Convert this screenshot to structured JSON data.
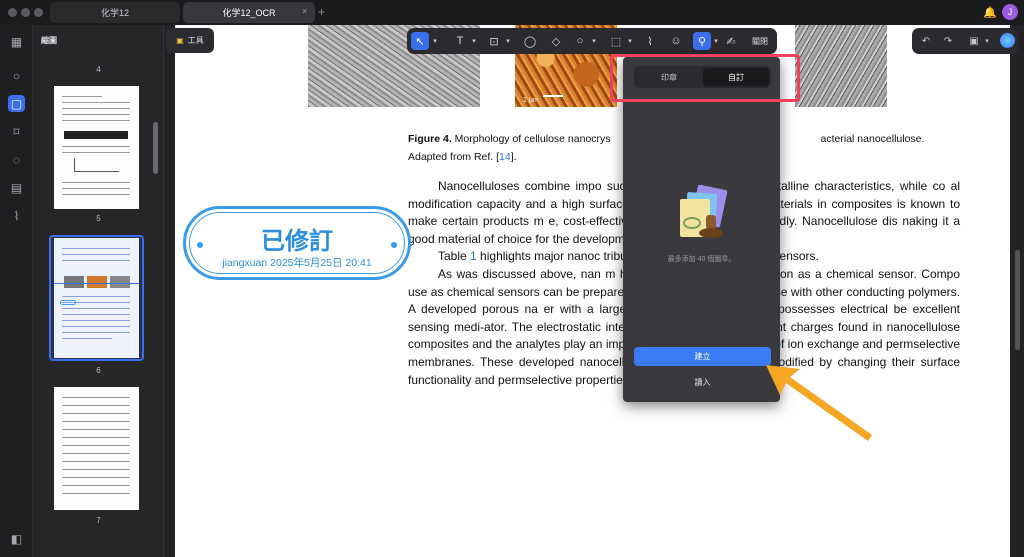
{
  "tabs": [
    {
      "label": "化学12"
    },
    {
      "label": "化学12_OCR",
      "close": "×"
    }
  ],
  "tab_add": "+",
  "user": {
    "initial": "J"
  },
  "thumbnails": {
    "title": "縮圖",
    "page_numbers": [
      "4",
      "5",
      "6",
      "7"
    ]
  },
  "tools_button": {
    "label": "工具"
  },
  "toolbar": {
    "close_label": "關閉"
  },
  "document": {
    "caption_bold": "Figure 4.",
    "caption_text1": " Morphology of cellulose nanocrys",
    "caption_text2": "acterial nanocellulose.",
    "caption_line2_pre": "Adapted from Ref. [",
    "caption_ref": "14",
    "caption_line2_post": "].",
    "scale_label": "1 µm",
    "p1": "Nanocelluloses combine impo                                such as hydrophilicity and crystalline characteristics, while co                          al modification capacity and a high surface area. The use of na                        er materials in composites is known to make certain products m                        e, cost-effective and environ-mentally friendly. Nanocellulose dis                      naking it a good material of choice for the development of chemica",
    "p2_pre": "Table ",
    "p2_ref": "1",
    "p2_post": " highlights major nanoc                              tribute to their use as chemi-cal sensors.",
    "p3": "As was discussed above, nan                              m has limitations in its appli-cation as a chemical sensor. Compo                        use as chemical sensors can be prepared through surface functi                          llulose with other conducting polymers. A developed porous na                         er with a large specific surface area that possesses electrical                          be excellent sensing medi-ator. The electrostatic interactions between the different charges found in nanocellulose composites and the analytes play an important role in the fabrication of ion exchange and permselective membranes. These developed nanocellulose composites can be modified by changing their surface functionality and permselective properties."
  },
  "stamp": {
    "title": "已修訂",
    "subtitle": "jiangxuan 2025年5月25日 20:41"
  },
  "stamp_popup": {
    "tabs": [
      {
        "label": "印章"
      },
      {
        "label": "自訂",
        "active": true
      }
    ],
    "empty_hint": "最多添加 40 個圖章。",
    "create_label": "建立",
    "import_label": "讀入"
  },
  "colors": {
    "accent": "#3b6ff0",
    "stamp": "#3a9be8",
    "highlight": "#f0425c",
    "arrow": "#f5a623"
  }
}
